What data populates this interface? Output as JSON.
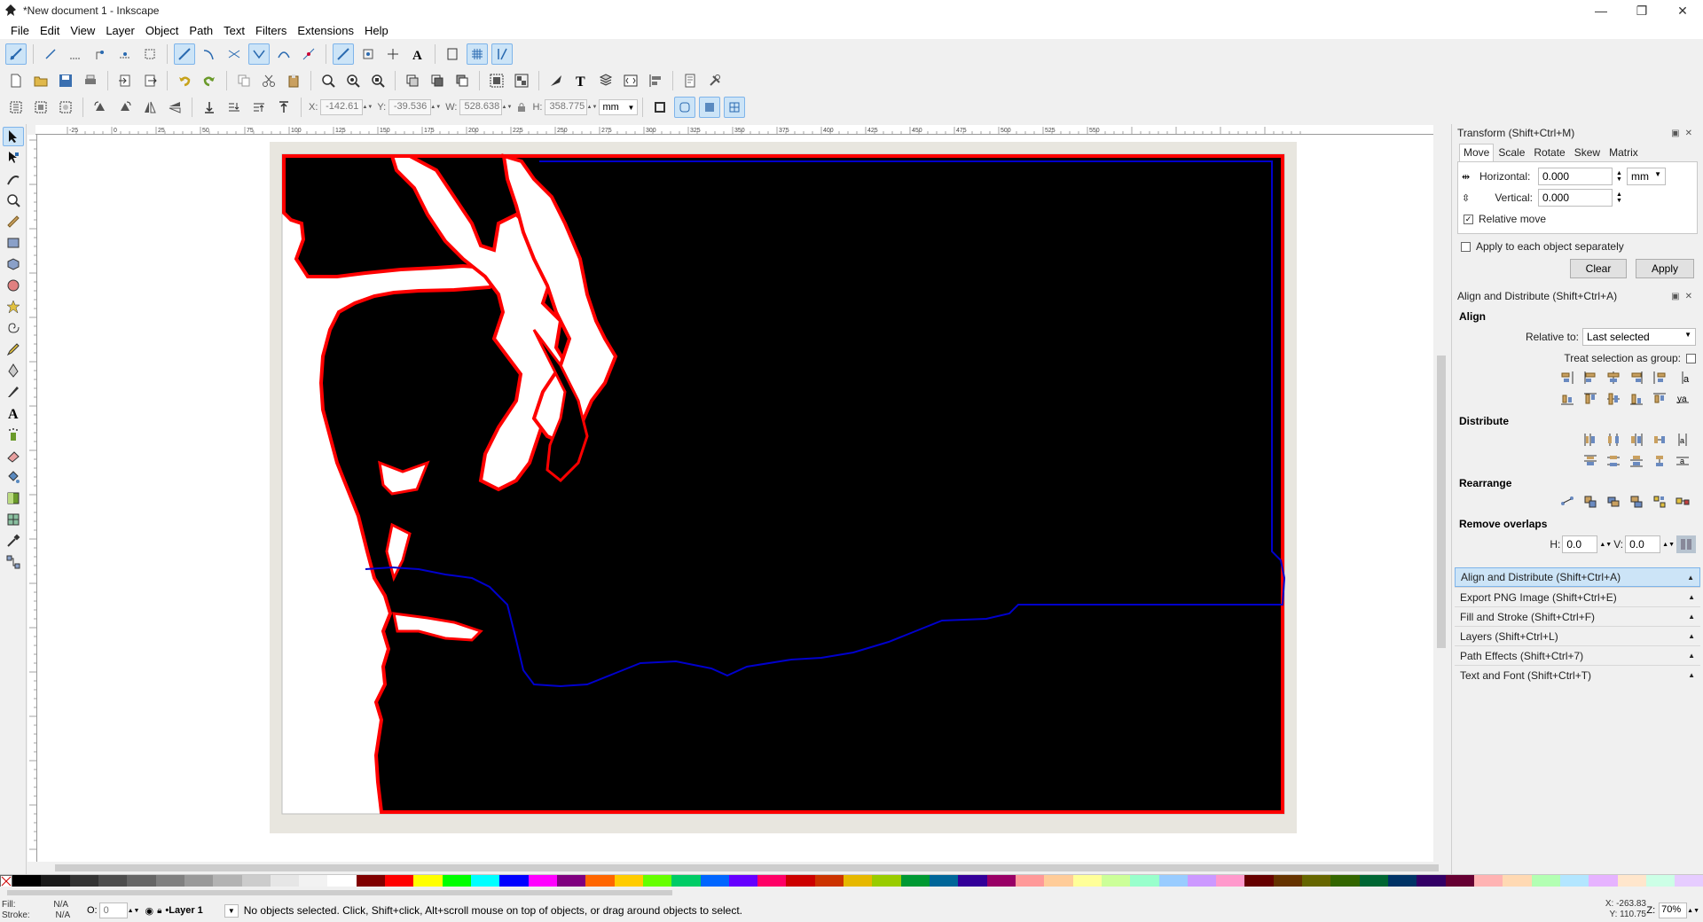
{
  "window": {
    "title": "*New document 1 - Inkscape",
    "min": "—",
    "max": "❐",
    "close": "✕"
  },
  "menu": [
    "File",
    "Edit",
    "View",
    "Layer",
    "Object",
    "Path",
    "Text",
    "Filters",
    "Extensions",
    "Help"
  ],
  "toolcontrols": {
    "x_label": "X:",
    "x_value": "-142.61",
    "y_label": "Y:",
    "y_value": "-39.536",
    "w_label": "W:",
    "w_value": "528.638",
    "h_label": "H:",
    "h_value": "358.775",
    "unit": "mm"
  },
  "ruler_labels": [
    "-25",
    "0",
    "25",
    "50",
    "75",
    "100",
    "125",
    "150",
    "175",
    "200",
    "225",
    "250",
    "275",
    "300",
    "325",
    "350",
    "375",
    "400",
    "425",
    "450",
    "475",
    "500",
    "525",
    "550"
  ],
  "transform": {
    "title": "Transform (Shift+Ctrl+M)",
    "tabs": [
      "Move",
      "Scale",
      "Rotate",
      "Skew",
      "Matrix"
    ],
    "horizontal_label": "Horizontal:",
    "horizontal_value": "0.000",
    "vertical_label": "Vertical:",
    "vertical_value": "0.000",
    "unit": "mm",
    "relative_move_label": "Relative move",
    "relative_move_checked": true,
    "apply_each_label": "Apply to each object separately",
    "apply_each_checked": false,
    "clear_label": "Clear",
    "apply_label": "Apply"
  },
  "align": {
    "title": "Align and Distribute (Shift+Ctrl+A)",
    "align_heading": "Align",
    "relative_to_label": "Relative to:",
    "relative_to_value": "Last selected",
    "treat_group_label": "Treat selection as group:",
    "distribute_heading": "Distribute",
    "rearrange_heading": "Rearrange",
    "remove_overlaps_heading": "Remove overlaps",
    "h_label": "H:",
    "h_value": "0.0",
    "v_label": "V:",
    "v_value": "0.0"
  },
  "collapsed_panels": [
    "Align and Distribute (Shift+Ctrl+A)",
    "Export PNG Image (Shift+Ctrl+E)",
    "Fill and Stroke (Shift+Ctrl+F)",
    "Layers (Shift+Ctrl+L)",
    "Path Effects  (Shift+Ctrl+7)",
    "Text and Font (Shift+Ctrl+T)"
  ],
  "status": {
    "fill_label": "Fill:",
    "fill_value": "N/A",
    "stroke_label": "Stroke:",
    "stroke_value": "N/A",
    "opacity_label": "O:",
    "opacity_value": "0",
    "layer": "•Layer 1",
    "message": "No objects selected. Click, Shift+click, Alt+scroll mouse on top of objects, or drag around objects to select.",
    "x_readout": "X: -263.83",
    "y_readout": "Y: 110.75",
    "zoom_label": "Z:",
    "zoom_value": "70%"
  },
  "palette_colors": [
    "#000000",
    "#1a1a1a",
    "#333333",
    "#4d4d4d",
    "#666666",
    "#808080",
    "#999999",
    "#b3b3b3",
    "#cccccc",
    "#e6e6e6",
    "#f2f2f2",
    "#ffffff",
    "#800000",
    "#ff0000",
    "#ffff00",
    "#00ff00",
    "#00ffff",
    "#0000ff",
    "#ff00ff",
    "#800080",
    "#ff6600",
    "#ffcc00",
    "#66ff00",
    "#00cc66",
    "#0066ff",
    "#6600ff",
    "#ff0066",
    "#cc0000",
    "#cc3300",
    "#e6b800",
    "#99cc00",
    "#009933",
    "#006699",
    "#330099",
    "#990066",
    "#ff9999",
    "#ffcc99",
    "#ffff99",
    "#ccff99",
    "#99ffcc",
    "#99ccff",
    "#cc99ff",
    "#ff99cc",
    "#660000",
    "#663300",
    "#666600",
    "#336600",
    "#006633",
    "#003366",
    "#330066",
    "#660033",
    "#ffb3b3",
    "#ffd9b3",
    "#b3ffb3",
    "#b3e6ff",
    "#e6b3ff",
    "#ffe6cc",
    "#ccffe6",
    "#e6ccff"
  ]
}
